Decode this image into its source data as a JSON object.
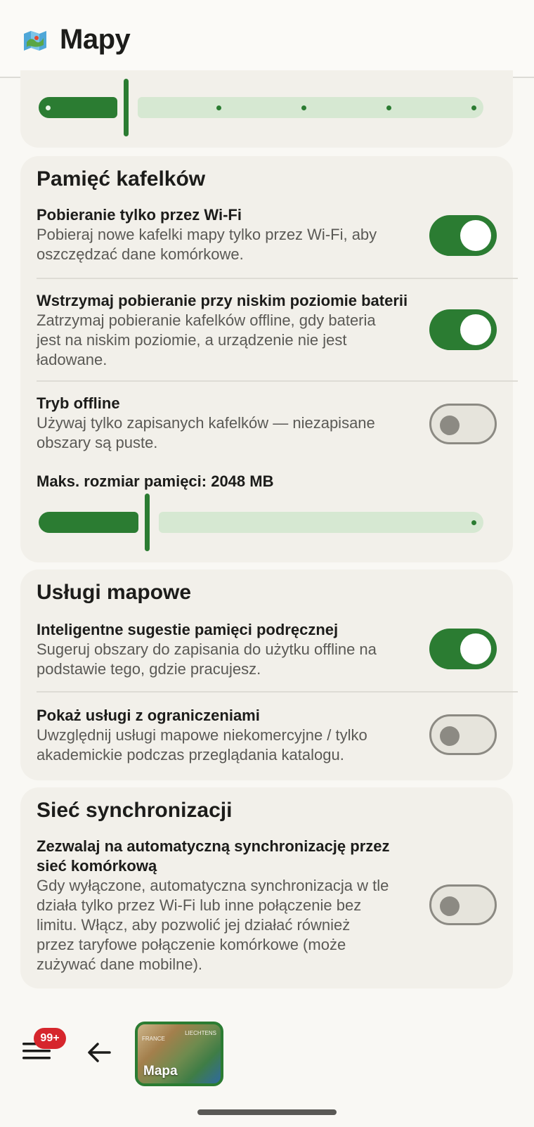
{
  "app": {
    "title": "Mapy",
    "icon": "map-icon"
  },
  "top_slider": {
    "value_fraction": 0.2,
    "stops": 6
  },
  "tile_cache": {
    "title": "Pamięć kafelków",
    "wifi_only": {
      "title": "Pobieranie tylko przez Wi-Fi",
      "desc_line1": "Pobieraj nowe kafelki mapy tylko przez Wi-Fi, aby",
      "desc_line2": "oszczędzać dane komórkowe.",
      "enabled": true
    },
    "low_battery": {
      "title": "Wstrzymaj pobieranie przy niskim poziomie baterii",
      "desc_line1": "Zatrzymaj pobieranie kafelków offline, gdy bateria",
      "desc_line2": "jest na niskim poziomie, a urządzenie nie jest",
      "desc_line3": "ładowane.",
      "enabled": true
    },
    "offline_mode": {
      "title": "Tryb offline",
      "desc_line1": "Używaj tylko zapisanych kafelków — niezapisane",
      "desc_line2": "obszary są puste.",
      "enabled": false
    },
    "max_size": {
      "label": "Maks. rozmiar pamięci: 2048 MB",
      "value_fraction": 0.25
    }
  },
  "map_services": {
    "title": "Usługi mapowe",
    "smart_cache": {
      "title": "Inteligentne sugestie pamięci podręcznej",
      "desc_line1": "Sugeruj obszary do zapisania do użytku offline na",
      "desc_line2": "podstawie tego, gdzie pracujesz.",
      "enabled": true
    },
    "restricted": {
      "title": "Pokaż usługi z ograniczeniami",
      "desc_line1": "Uwzględnij usługi mapowe niekomercyjne / tylko",
      "desc_line2": "akademickie podczas przeglądania katalogu.",
      "enabled": false
    }
  },
  "sync_network": {
    "title": "Sieć synchronizacji",
    "cellular_sync": {
      "title_line1": "Zezwalaj na automatyczną synchronizację przez",
      "title_line2": "sieć komórkową",
      "desc_line1": "Gdy wyłączone, automatyczna synchronizacja w tle",
      "desc_line2": "działa tylko przez Wi-Fi lub inne połączenie bez",
      "desc_line3": "limitu. Włącz, aby pozwolić jej działać również",
      "desc_line4": "przez taryfowe połączenie komórkowe (może",
      "desc_line5": "zużywać dane mobilne).",
      "enabled": false
    }
  },
  "bottom_bar": {
    "badge": "99+",
    "menu_icon": "hamburger-menu-icon",
    "back_icon": "arrow-left-icon",
    "map_thumb_label": "Mapa",
    "map_thumb_text1": "FRANCE",
    "map_thumb_text2": "LIECHTENS"
  }
}
